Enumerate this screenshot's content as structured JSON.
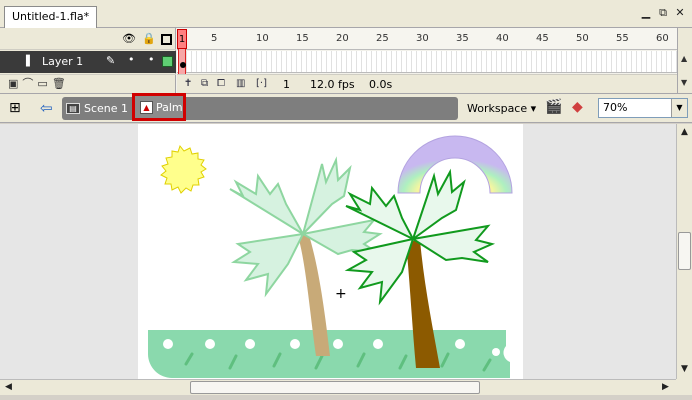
{
  "document": {
    "tab_title": "Untitled-1.fla*"
  },
  "window_controls": {
    "minimize": "▁",
    "restore": "⧉",
    "close": "✕"
  },
  "timeline": {
    "ruler_labels": [
      "1",
      "5",
      "10",
      "15",
      "20",
      "25",
      "30",
      "35",
      "40",
      "45",
      "50",
      "55",
      "60"
    ],
    "layer": {
      "name": "Layer 1"
    },
    "status": {
      "current_frame": "1",
      "frame_rate": "12.0 fps",
      "elapsed_time": "0.0s"
    }
  },
  "edit_bar": {
    "breadcrumbs": [
      {
        "label": "Scene 1"
      },
      {
        "label": "Palm"
      }
    ],
    "workspace_label": "Workspace ▾",
    "zoom_value": "70%"
  },
  "icons": {
    "eye": "eye-icon",
    "lock": "lock-icon",
    "outline": "outline-icon",
    "edit_stage": "stage-icon",
    "back": "back-arrow-icon",
    "scene": "scene-clapper-icon",
    "symbol": "graphic-symbol-icon",
    "edit_scene": "edit-scene-icon",
    "edit_symbol": "edit-symbol-icon"
  },
  "colors": {
    "playhead": "#ff8080",
    "highlight_box": "#d10000",
    "sun": "#ffff8c",
    "trunk_light": "#c8aa78",
    "trunk_dark": "#8c5a00",
    "palm_light": "#8ed6a0",
    "palm_dark": "#119a1e",
    "ground": "#8ad9ad"
  }
}
